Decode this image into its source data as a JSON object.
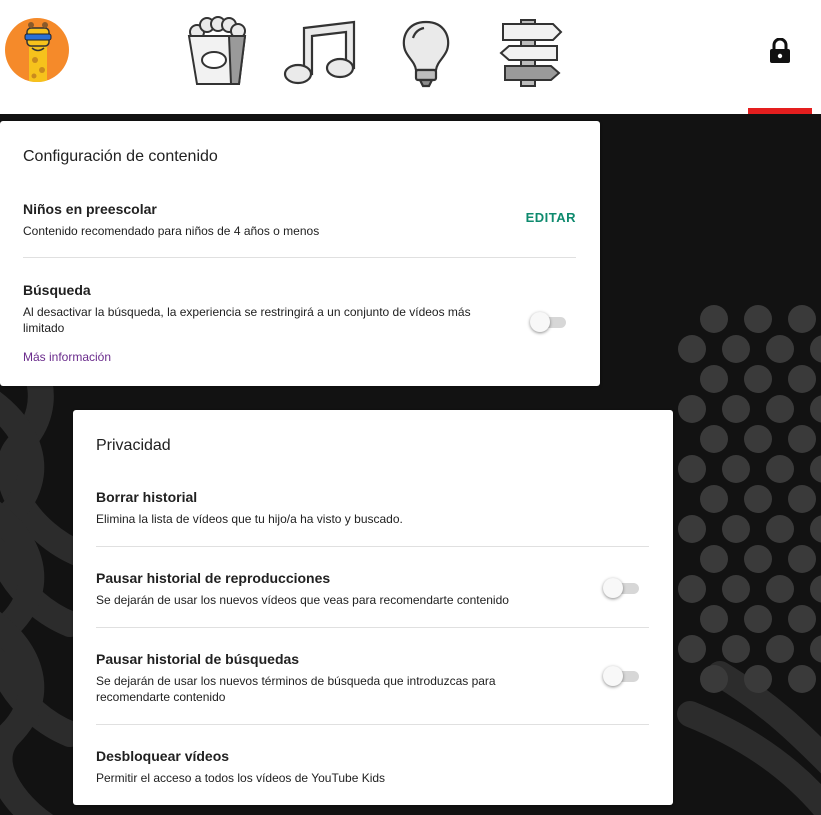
{
  "header": {
    "nav": [
      {
        "name": "shows",
        "icon": "popcorn-icon"
      },
      {
        "name": "music",
        "icon": "music-note-icon"
      },
      {
        "name": "learning",
        "icon": "lightbulb-icon"
      },
      {
        "name": "explore",
        "icon": "signpost-icon"
      }
    ],
    "profile_icon": "giraffe-avatar",
    "lock_icon": "lock-icon",
    "accent_color": "#e41e1e"
  },
  "content_settings": {
    "title": "Configuración de contenido",
    "preschool": {
      "title": "Niños en preescolar",
      "description": "Contenido recomendado para niños de 4 años o menos",
      "edit_label": "EDITAR"
    },
    "search": {
      "title": "Búsqueda",
      "description": "Al desactivar la búsqueda, la experiencia se restringirá a un conjunto de vídeos más limitado",
      "enabled": false,
      "more_info_label": "Más información"
    }
  },
  "privacy": {
    "title": "Privacidad",
    "clear_history": {
      "title": "Borrar historial",
      "description": "Elimina la lista de vídeos que tu hijo/a ha visto y buscado."
    },
    "pause_watch_history": {
      "title": "Pausar historial de reproducciones",
      "description": "Se dejarán de usar los nuevos vídeos que veas para recomendarte contenido",
      "enabled": false
    },
    "pause_search_history": {
      "title": "Pausar historial de búsquedas",
      "description": "Se dejarán de usar los nuevos términos de búsqueda que introduzcas para recomendarte contenido",
      "enabled": false
    },
    "unblock_videos": {
      "title": "Desbloquear vídeos",
      "description": "Permitir el acceso a todos los vídeos de YouTube Kids"
    }
  },
  "colors": {
    "edit_green": "#0e8a6e",
    "link_purple": "#6a2b8c",
    "background": "#121212"
  }
}
